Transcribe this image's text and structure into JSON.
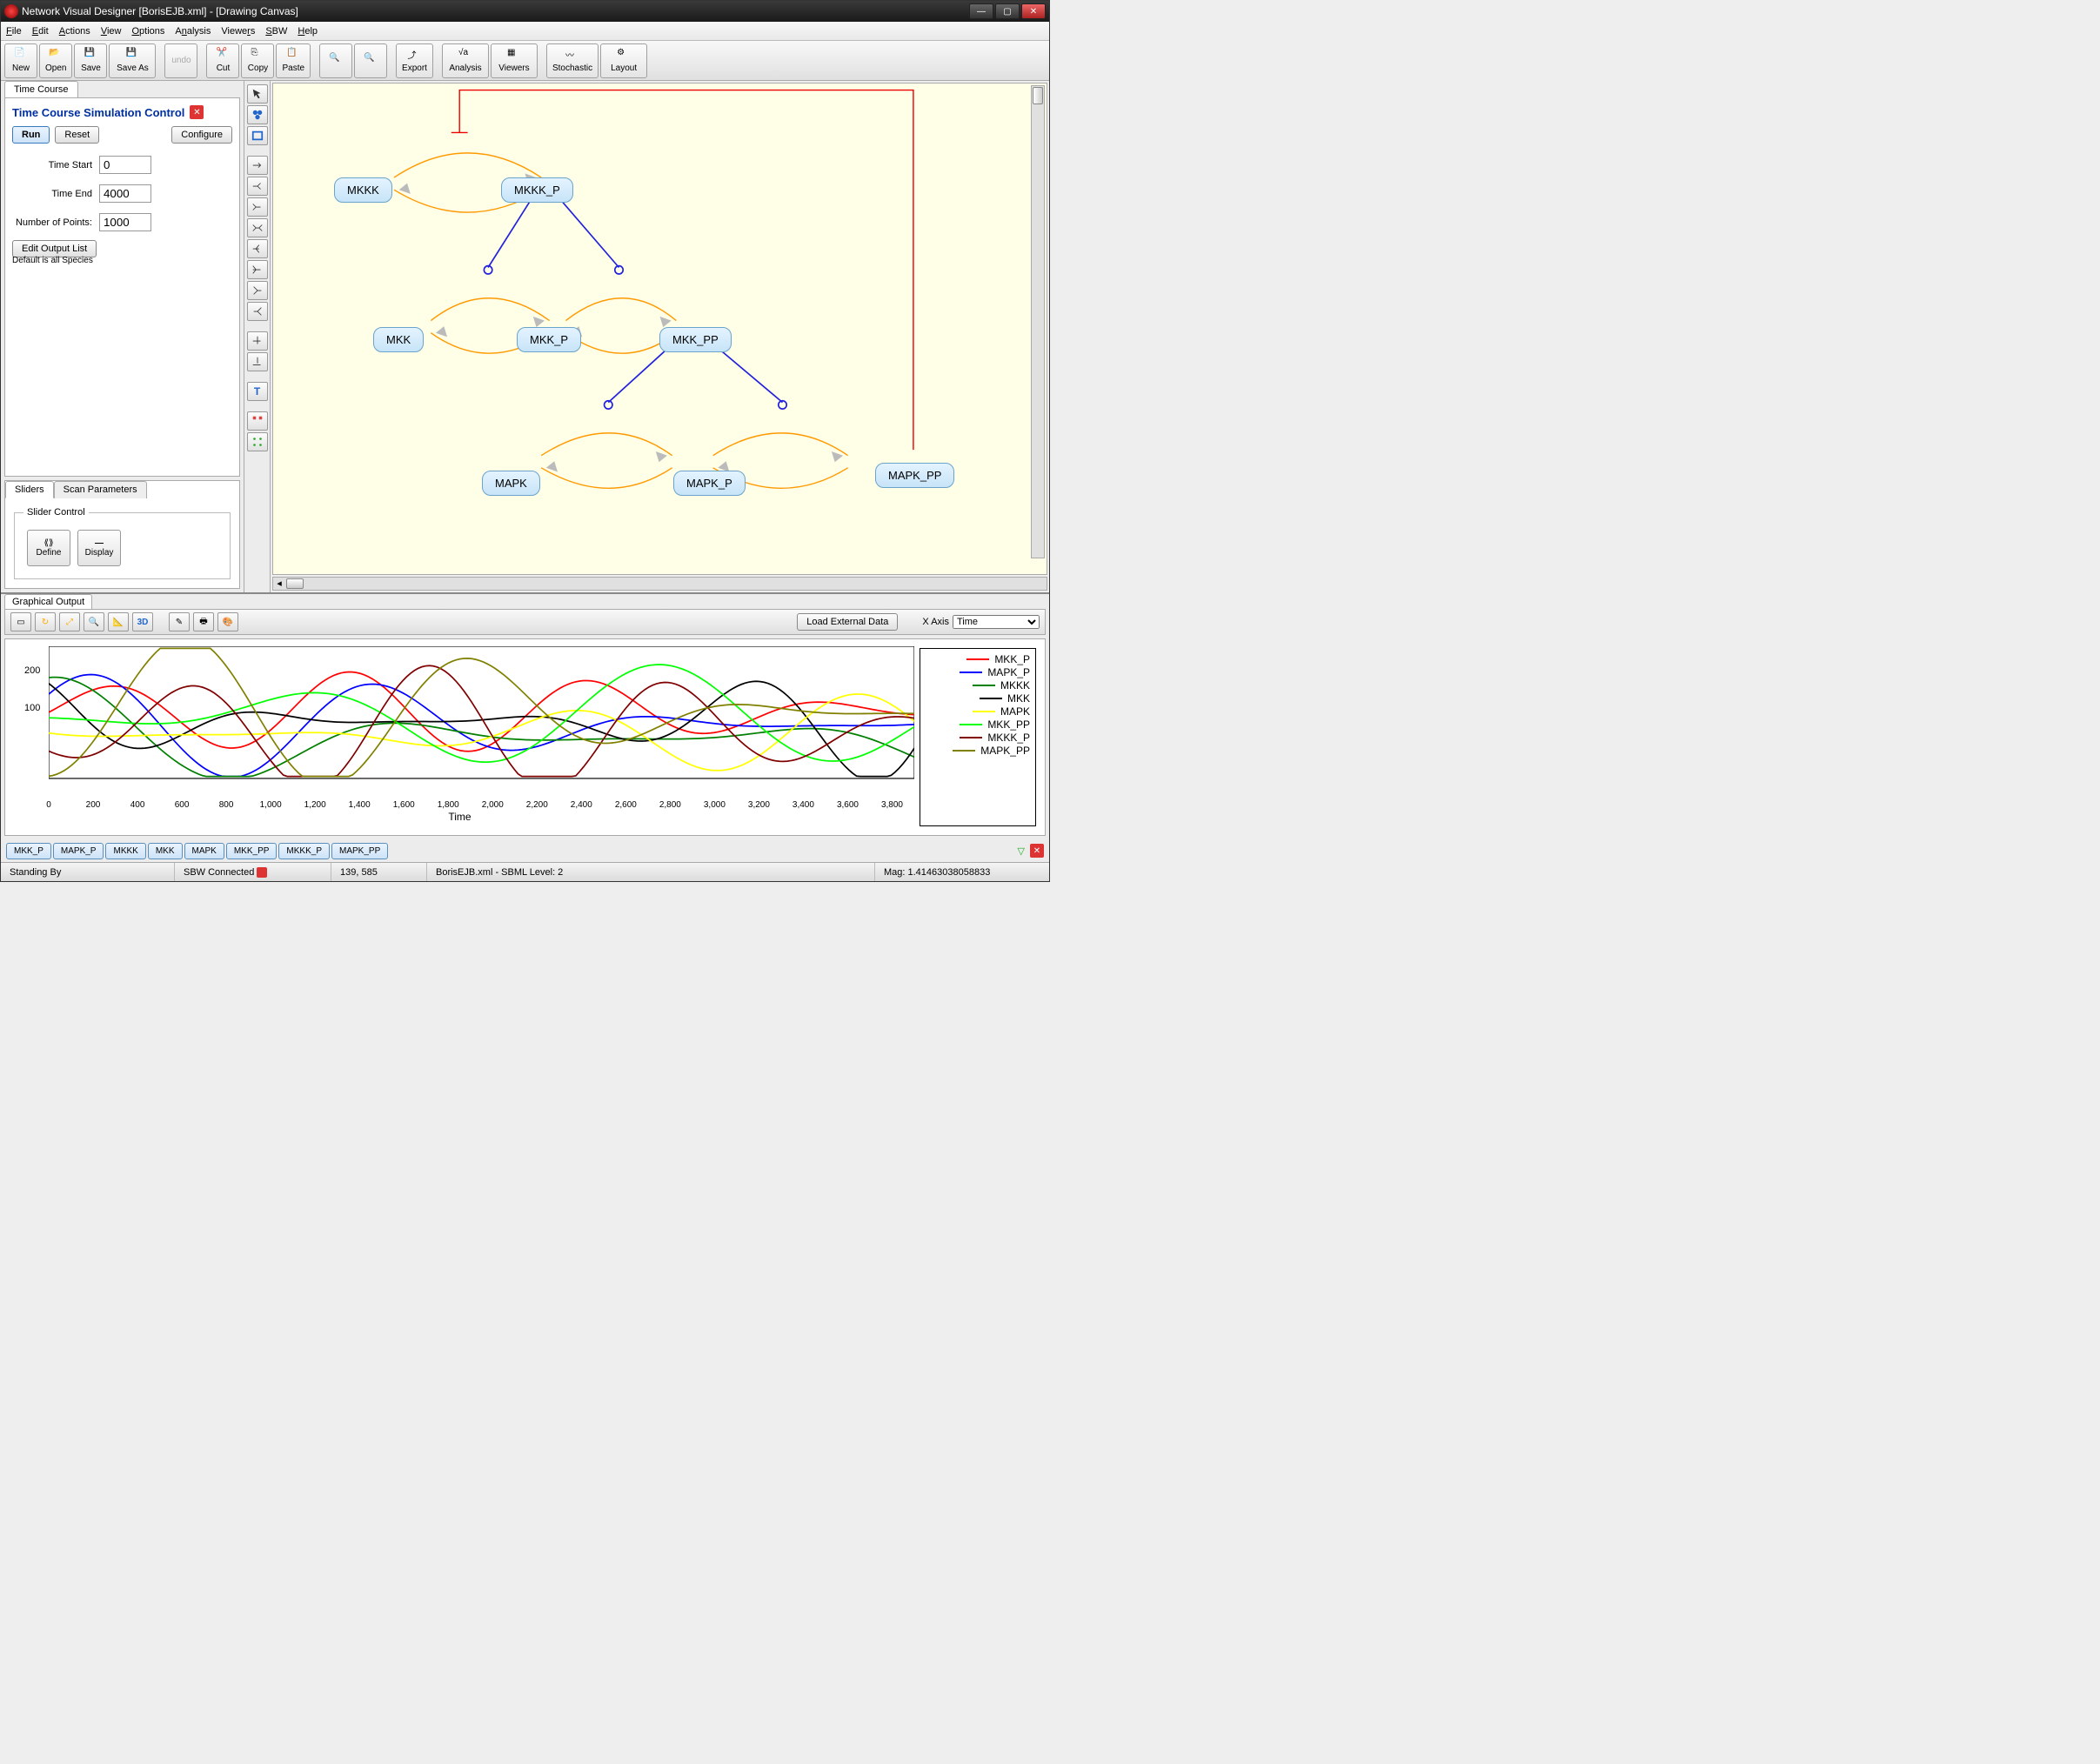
{
  "window": {
    "title": "Network Visual Designer [BorisEJB.xml] - [Drawing Canvas]"
  },
  "menu": [
    "File",
    "Edit",
    "Actions",
    "View",
    "Options",
    "Analysis",
    "Viewers",
    "SBW",
    "Help"
  ],
  "toolbar": [
    {
      "label": "New",
      "icon": "file-new"
    },
    {
      "label": "Open",
      "icon": "folder-open"
    },
    {
      "label": "Save",
      "icon": "disk"
    },
    {
      "label": "Save As",
      "icon": "disk-as"
    },
    {
      "sep": true
    },
    {
      "label": "undo",
      "icon": "undo",
      "disabled": true
    },
    {
      "sep": true
    },
    {
      "label": "Cut",
      "icon": "scissors"
    },
    {
      "label": "Copy",
      "icon": "copy"
    },
    {
      "label": "Paste",
      "icon": "paste"
    },
    {
      "sep": true
    },
    {
      "label": "",
      "icon": "zoom-in"
    },
    {
      "label": "",
      "icon": "zoom-out"
    },
    {
      "sep": true
    },
    {
      "label": "Export",
      "icon": "export"
    },
    {
      "sep": true
    },
    {
      "label": "Analysis",
      "icon": "analysis"
    },
    {
      "label": "Viewers",
      "icon": "viewers"
    },
    {
      "sep": true
    },
    {
      "label": "Stochastic",
      "icon": "stochastic"
    },
    {
      "label": "Layout",
      "icon": "layout"
    }
  ],
  "timecourse": {
    "tab": "Time Course",
    "title": "Time Course Simulation Control",
    "run": "Run",
    "reset": "Reset",
    "configure": "Configure",
    "time_start_lbl": "Time Start",
    "time_start": "0",
    "time_end_lbl": "Time End",
    "time_end": "4000",
    "npoints_lbl": "Number of Points:",
    "npoints": "1000",
    "edit_output": "Edit Output List",
    "default_note": "Default is all Species"
  },
  "sliders": {
    "tab1": "Sliders",
    "tab2": "Scan Parameters",
    "legend": "Slider Control",
    "define": "Define",
    "display": "Display"
  },
  "nodes": {
    "mkkk": "MKKK",
    "mkkk_p": "MKKK_P",
    "mkk": "MKK",
    "mkk_p": "MKK_P",
    "mkk_pp": "MKK_PP",
    "mapk": "MAPK",
    "mapk_p": "MAPK_P",
    "mapk_pp": "MAPK_PP"
  },
  "graphout": {
    "tab": "Graphical Output",
    "load": "Load External Data",
    "xaxis_lbl": "X Axis",
    "xaxis_sel": "Time"
  },
  "chart_data": {
    "type": "line",
    "xlabel": "Time",
    "ylabel": "",
    "xlim": [
      0,
      3900
    ],
    "ylim": [
      0,
      300
    ],
    "xticks": [
      0,
      200,
      400,
      600,
      800,
      1000,
      1200,
      1400,
      1600,
      1800,
      2000,
      2200,
      2400,
      2600,
      2800,
      3000,
      3200,
      3400,
      3600,
      3800
    ],
    "yticks": [
      100,
      200
    ],
    "series": [
      {
        "name": "MKK_P",
        "color": "#ff0000"
      },
      {
        "name": "MAPK_P",
        "color": "#0000ff"
      },
      {
        "name": "MKKK",
        "color": "#008000"
      },
      {
        "name": "MKK",
        "color": "#000000"
      },
      {
        "name": "MAPK",
        "color": "#ffff00"
      },
      {
        "name": "MKK_PP",
        "color": "#00ff00"
      },
      {
        "name": "MKKK_P",
        "color": "#800000"
      },
      {
        "name": "MAPK_PP",
        "color": "#808000"
      }
    ]
  },
  "species_btns": [
    "MKK_P",
    "MAPK_P",
    "MKKK",
    "MKK",
    "MAPK",
    "MKK_PP",
    "MKKK_P",
    "MAPK_PP"
  ],
  "status": {
    "standing": "Standing By",
    "sbw": "SBW Connected",
    "coords": "139, 585",
    "file": "BorisEJB.xml - SBML Level: 2",
    "mag": "Mag: 1.41463038058833"
  }
}
